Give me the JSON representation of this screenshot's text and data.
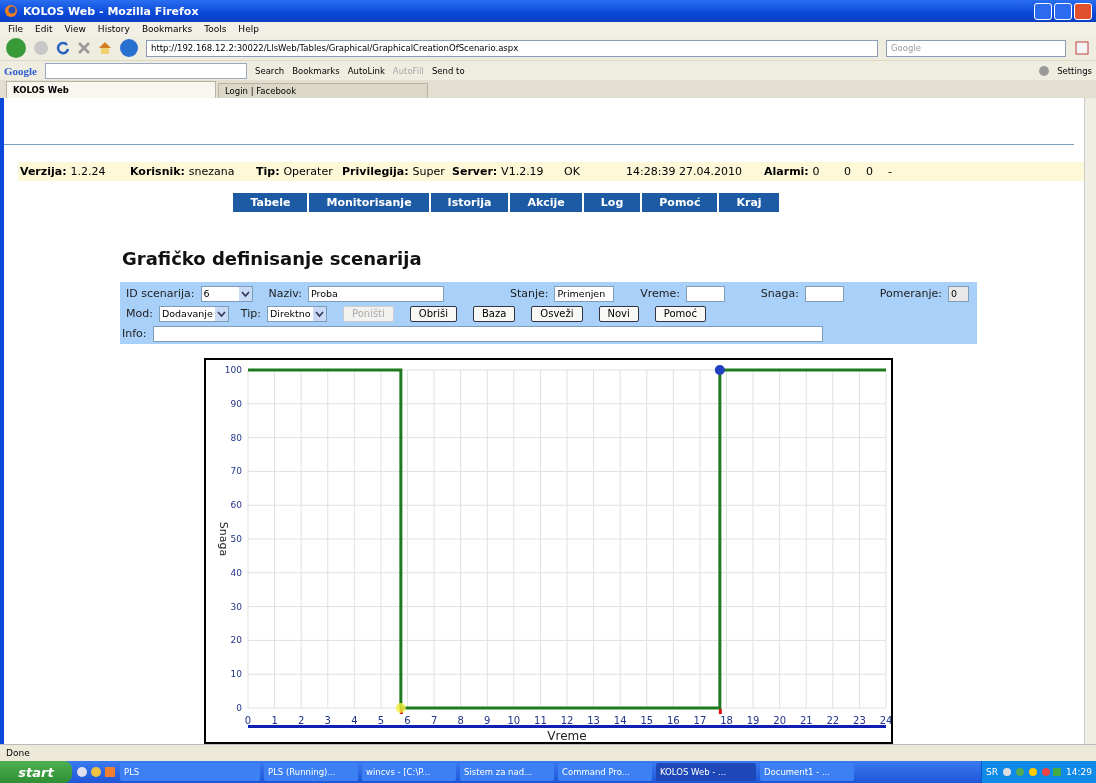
{
  "window": {
    "title": "KOLOS Web - Mozilla Firefox"
  },
  "menu": [
    "File",
    "Edit",
    "View",
    "History",
    "Bookmarks",
    "Tools",
    "Help"
  ],
  "address": {
    "url": "http://192.168.12.2:30022/LlsWeb/Tables/Graphical/GraphicalCreationOfScenario.aspx"
  },
  "search": {
    "placeholder": "Google"
  },
  "google_toolbar": {
    "logo": "Google",
    "items": [
      {
        "label": "Search",
        "disabled": false
      },
      {
        "label": "Bookmarks",
        "disabled": false
      },
      {
        "label": "AutoLink",
        "disabled": false
      },
      {
        "label": "AutoFill",
        "disabled": true
      },
      {
        "label": "Send to",
        "disabled": false
      }
    ],
    "settings": "Settings"
  },
  "tabs": [
    {
      "label": "KOLOS Web",
      "selected": true
    },
    {
      "label": "Login | Facebook",
      "selected": false
    }
  ],
  "info_bar": [
    {
      "label": "Verzija:",
      "value": "1.2.24"
    },
    {
      "label": "Korisnik:",
      "value": "snezana"
    },
    {
      "label": "Tip:",
      "value": "Operater"
    },
    {
      "label": "Privilegija:",
      "value": "Super"
    },
    {
      "label": "Server:",
      "value": "V1.2.19"
    },
    {
      "value": "OK"
    },
    {
      "value": "14:28:39 27.04.2010"
    },
    {
      "label": "Alarmi:",
      "value": "0"
    },
    {
      "value": "0"
    },
    {
      "value": "0"
    },
    {
      "value": "-"
    }
  ],
  "nav": [
    "Tabele",
    "Monitorisanje",
    "Istorija",
    "Akcije",
    "Log",
    "Pomoć",
    "Kraj"
  ],
  "heading": "Grafičko definisanje scenarija",
  "form": {
    "row1": [
      {
        "kind": "select",
        "label": "ID scenarija:",
        "value": "6"
      },
      {
        "kind": "input",
        "label": "Naziv:",
        "value": "Proba"
      },
      {
        "kind": "input",
        "label": "Stanje:",
        "value": "Primenjen"
      },
      {
        "kind": "input",
        "label": "Vreme:"
      },
      {
        "kind": "input",
        "label": "Snaga:"
      },
      {
        "kind": "readonly",
        "label": "Pomeranje:",
        "value": "0"
      }
    ],
    "row2": [
      {
        "kind": "select",
        "label": "Mod:",
        "value": "Dodavanje"
      },
      {
        "kind": "select",
        "label": "Tip:",
        "value": "Direktno"
      }
    ],
    "buttons": [
      {
        "label": "Poništi",
        "disabled": true
      },
      {
        "label": "Obriši",
        "disabled": false
      },
      {
        "label": "Baza",
        "disabled": false
      },
      {
        "label": "Osveži",
        "disabled": false
      },
      {
        "label": "Novi",
        "disabled": false
      },
      {
        "label": "Pomoć",
        "disabled": false
      }
    ],
    "info_label": "Info:"
  },
  "chart_data": {
    "type": "line",
    "xlabel": "Vreme",
    "ylabel": "Snaga",
    "x": [
      0,
      5.75,
      5.75,
      17.75,
      17.75,
      24
    ],
    "grid": true,
    "series": [
      {
        "color": "#1e7a1e",
        "values": [
          100,
          100,
          0,
          0,
          100,
          100
        ]
      }
    ],
    "xlim": [
      0,
      24
    ],
    "ylim": [
      0,
      100
    ],
    "xticks": [
      0,
      1,
      2,
      3,
      4,
      5,
      6,
      7,
      8,
      9,
      10,
      11,
      12,
      13,
      14,
      15,
      16,
      17,
      18,
      19,
      20,
      21,
      22,
      23,
      24
    ],
    "yticks": [
      0,
      10,
      20,
      30,
      40,
      50,
      60,
      70,
      80,
      90,
      100
    ]
  },
  "status_bar": "Done",
  "taskbar": {
    "start": "start",
    "tasks": [
      {
        "label": "PLS",
        "selected": false
      },
      {
        "label": "PLS (Running)...",
        "selected": false
      },
      {
        "label": "wincvs - [C:\\P...",
        "selected": false
      },
      {
        "label": "Sistem za nad...",
        "selected": false
      },
      {
        "label": "Command Pro...",
        "selected": false
      },
      {
        "label": "KOLOS Web - ...",
        "selected": true
      },
      {
        "label": "Document1 - ...",
        "selected": false
      }
    ],
    "language": "SR",
    "clock": "14:29"
  }
}
